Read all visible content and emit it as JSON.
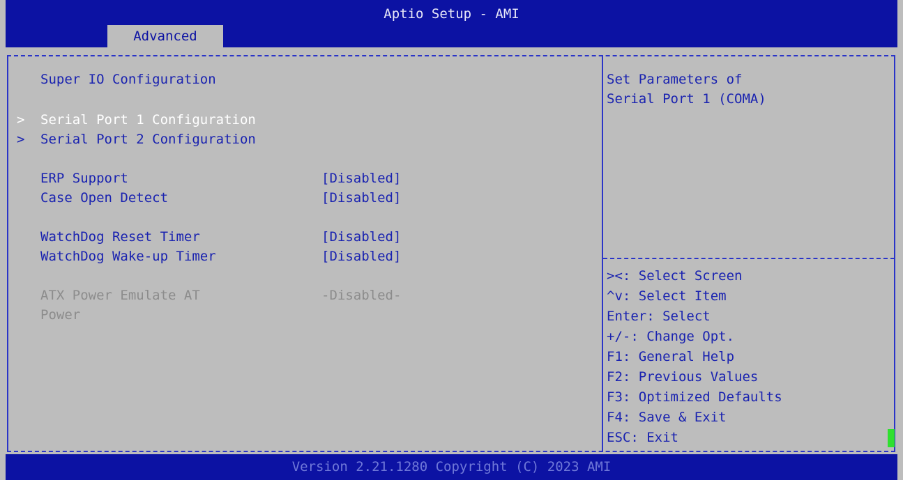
{
  "header": {
    "title": "Aptio Setup - AMI",
    "active_tab": "Advanced"
  },
  "main": {
    "heading": "Super IO Configuration",
    "submenus": [
      {
        "marker": ">",
        "label": "Serial Port 1 Configuration"
      },
      {
        "marker": ">",
        "label": "Serial Port 2 Configuration"
      }
    ],
    "settings": [
      {
        "label": "ERP Support",
        "value": "[Disabled]"
      },
      {
        "label": "Case Open Detect",
        "value": "[Disabled]"
      },
      {
        "label": "WatchDog Reset Timer",
        "value": "[Disabled]"
      },
      {
        "label": "WatchDog Wake-up Timer",
        "value": "[Disabled]"
      }
    ],
    "disabled_setting": {
      "label_line1": "ATX Power Emulate AT",
      "label_line2": "Power",
      "value": "-Disabled-"
    }
  },
  "help": {
    "line1": "Set Parameters of",
    "line2": "Serial Port 1 (COMA)"
  },
  "keys": [
    "><: Select Screen",
    "^v: Select Item",
    "Enter: Select",
    "+/-: Change Opt.",
    "F1: General Help",
    "F2: Previous Values",
    "F3: Optimized Defaults",
    "F4: Save & Exit",
    "ESC: Exit"
  ],
  "footer": {
    "version": "Version 2.21.1280 Copyright (C) 2023 AMI"
  },
  "colors": {
    "header_bg": "#0c12a3",
    "body_bg": "#bdbdbd",
    "text_blue": "#1a23b0",
    "selected": "#ffffff",
    "disabled": "#8c8c8c"
  }
}
